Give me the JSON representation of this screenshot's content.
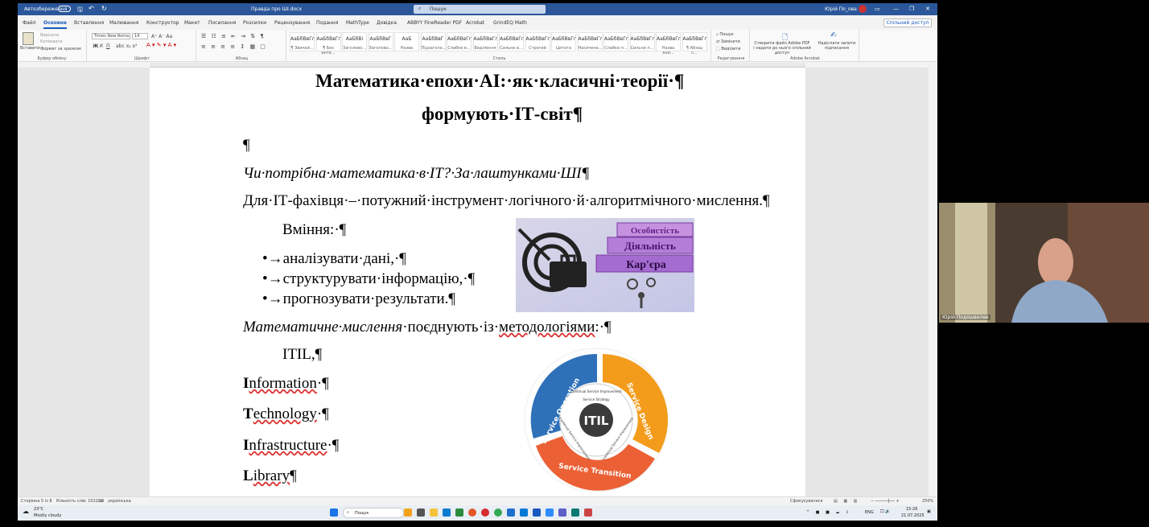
{
  "titlebar": {
    "autosave": "Автозбереження",
    "doc_name": "Правда про ШІ.docx",
    "search": "Пошук",
    "user": "Юрій По_ова",
    "minimize": "—",
    "restore": "❐",
    "close": "✕"
  },
  "menu": {
    "tabs": [
      "Файл",
      "Основне",
      "Вставлення",
      "Малювання",
      "Конструктор",
      "Макет",
      "Посилання",
      "Розсилки",
      "Рецензування",
      "Подання",
      "MathType",
      "Довідка",
      "ABBYY FineReader PDF",
      "Acrobat",
      "GrindEQ Math"
    ],
    "share": "Спільний доступ"
  },
  "ribbon": {
    "paste": "Вставити",
    "cut": "Вирізати",
    "copy": "Копіювати",
    "format_painter": "Формат за зразком",
    "clipboard": "Буфер обміну",
    "font_name": "Times New Roma",
    "font_size": "14",
    "font_group": "Шрифт",
    "paragraph_group": "Абзац",
    "styles_group": "Стиль",
    "styles": [
      {
        "sample": "АаБбВвГг",
        "name": "¶ Звичай..."
      },
      {
        "sample": "АаБбВвГг",
        "name": "¶ Без инте..."
      },
      {
        "sample": "АаБбВі",
        "name": "Заголово..."
      },
      {
        "sample": "АаБбВвГ",
        "name": "Заголово..."
      },
      {
        "sample": "АаБ",
        "name": "Назва"
      },
      {
        "sample": "АаБбВвГ",
        "name": "Підзаголо..."
      },
      {
        "sample": "АаБбВвГг",
        "name": "Слабке в..."
      },
      {
        "sample": "АаБбВвГг",
        "name": "Виділення"
      },
      {
        "sample": "АаБбВвГг",
        "name": "Сильне в..."
      },
      {
        "sample": "АаБбВвГг",
        "name": "Строгий"
      },
      {
        "sample": "АаБбВвГг",
        "name": "Цитата"
      },
      {
        "sample": "АаБбВвГг",
        "name": "Насичена..."
      },
      {
        "sample": "АаБбВвГг",
        "name": "Слабке п..."
      },
      {
        "sample": "АаБбВвГг",
        "name": "Сильне п..."
      },
      {
        "sample": "АаБбВвГг",
        "name": "Назва кни..."
      },
      {
        "sample": "АаБбВвГг",
        "name": "¶ Абзац с..."
      }
    ],
    "find": "Пошук",
    "replace": "Замінити",
    "select": "Виділити",
    "editing_group": "Редагування",
    "acrobat_create": "Створити файл Adobe PDF і надати до нього спільний доступ",
    "acrobat_sign": "Надіслати запити підписання",
    "acrobat_group": "Adobe Acrobat"
  },
  "document": {
    "title_line1": "Математика·епохи·АІ:·як·класичні·теорії·¶",
    "title_line2": "формують·ІТ-світ¶",
    "empty_para": "¶",
    "question": "Чи·потрібна·математика·в·ІТ?·За·лаштунками·ШІ¶",
    "for_it": "Для·ІТ-фахівця·–·потужний·інструмент·логічного·й·алгоритмічного·мислення.¶",
    "skills_label": "Вміння:·¶",
    "bullets": [
      "аналізувати·дані,·¶",
      "структурувати·інформацію,·¶",
      "прогнозувати·результати.¶"
    ],
    "math_thinking_italic": "Математичне·мислення",
    "math_thinking_mid": "·поєднують·із·",
    "math_thinking_ul": "методологіями",
    "math_thinking_end": ":·¶",
    "itil_label": "ITIL,¶",
    "itil_words": [
      {
        "first": "I",
        "rest": "nformation",
        "end": "·¶"
      },
      {
        "first": "T",
        "rest": "echnology",
        "end": "·¶"
      },
      {
        "first": "I",
        "rest": "nfrastructure",
        "end": "·¶"
      },
      {
        "first": "L",
        "rest": "ibrary",
        "end": "¶"
      }
    ],
    "career_image": {
      "labels": [
        "Особистість",
        "Діяльність",
        "Кар'єра"
      ]
    },
    "itil_image": {
      "center": "ITIL",
      "outer": [
        "Service Operation",
        "Service Design",
        "Service Transition"
      ],
      "inner": [
        "Continual Service Improvement",
        "Service Strategy",
        "Continual Service Improvement",
        "Continual Service Improvement"
      ]
    }
  },
  "statusbar": {
    "page": "Сторінка 5 із 8",
    "words": "Кількість слів: 1022",
    "lang": "українська",
    "focus": "Сфокусуватися",
    "zoom": "250%"
  },
  "taskbar": {
    "temp": "23°C",
    "weather": "Mostly cloudy",
    "search": "Пошук",
    "lang": "ENG",
    "time": "15:26",
    "date": "21.07.2025"
  },
  "webcam": {
    "name": "Юрій Подошвелев"
  }
}
